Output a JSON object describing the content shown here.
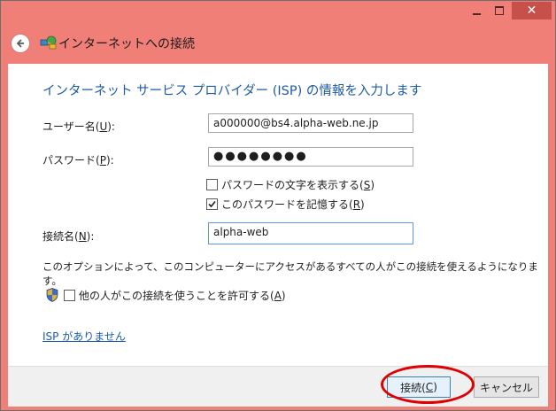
{
  "window": {
    "title": "インターネットへの接続",
    "icons": {
      "back": "back-arrow-icon",
      "title": "network-connection-icon",
      "minimize": "minimize-icon",
      "maximize": "maximize-icon",
      "close": "close-icon"
    },
    "colors": {
      "frame": "#f07f78",
      "close_button": "#c7504a",
      "accent": "#1c5ba7",
      "highlight": "#e00000"
    }
  },
  "form": {
    "heading": "インターネット サービス プロバイダー (ISP) の情報を入力します",
    "username": {
      "label": "ユーザー名(",
      "accel": "U",
      "label_end": "):",
      "value": "a000000@bs4.alpha-web.ne.jp"
    },
    "password": {
      "label": "パスワード(",
      "accel": "P",
      "label_end": "):",
      "value": "●●●●●●●●"
    },
    "show_chars": {
      "label": "パスワードの文字を表示する(",
      "accel": "S",
      "label_end": ")",
      "checked": false
    },
    "remember": {
      "label": "このパスワードを記憶する(",
      "accel": "R",
      "label_end": ")",
      "checked": true
    },
    "connection_name": {
      "label": "接続名(",
      "accel": "N",
      "label_end": "):",
      "value": "alpha-web"
    },
    "info_text": "このオプションによって、このコンピューターにアクセスがあるすべての人がこの接続を使えるようになります。",
    "allow_others": {
      "label": "他の人がこの接続を使うことを許可する(",
      "accel": "A",
      "label_end": ")",
      "checked": false,
      "icon": "uac-shield-icon"
    },
    "no_isp_link": "ISP がありません"
  },
  "footer": {
    "connect": {
      "label": "接続(",
      "accel": "C",
      "label_end": ")"
    },
    "cancel": "キャンセル"
  }
}
